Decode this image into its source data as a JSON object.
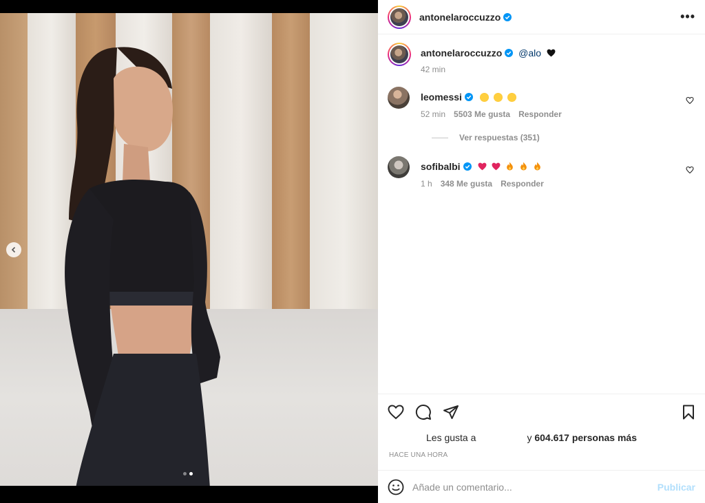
{
  "post": {
    "author": "antonelaroccuzzo",
    "caption_mention": "@alo",
    "caption_time": "42 min",
    "slide_count": 2,
    "active_slide": 2
  },
  "comments": [
    {
      "user": "leomessi",
      "time": "52 min",
      "likes": "5503 Me gusta",
      "reply_label": "Responder",
      "view_replies": "Ver respuestas (351)"
    },
    {
      "user": "sofibalbi",
      "time": "1 h",
      "likes": "348 Me gusta",
      "reply_label": "Responder"
    }
  ],
  "likes": {
    "prefix": "Les gusta a",
    "suffix_y": "y",
    "count": "604.617 personas más"
  },
  "time_ago": "HACE UNA HORA",
  "add_comment": {
    "placeholder": "Añade un comentario...",
    "publish_label": "Publicar"
  },
  "colors": {
    "verified": "#0095f6",
    "link": "#00376b",
    "publish_disabled": "#b2dffc"
  },
  "icons": {
    "more": "more-options-icon",
    "like": "heart-icon",
    "comment": "comment-icon",
    "share": "send-icon",
    "save": "bookmark-icon",
    "emoji": "smiley-icon",
    "prev": "chevron-left-icon"
  }
}
